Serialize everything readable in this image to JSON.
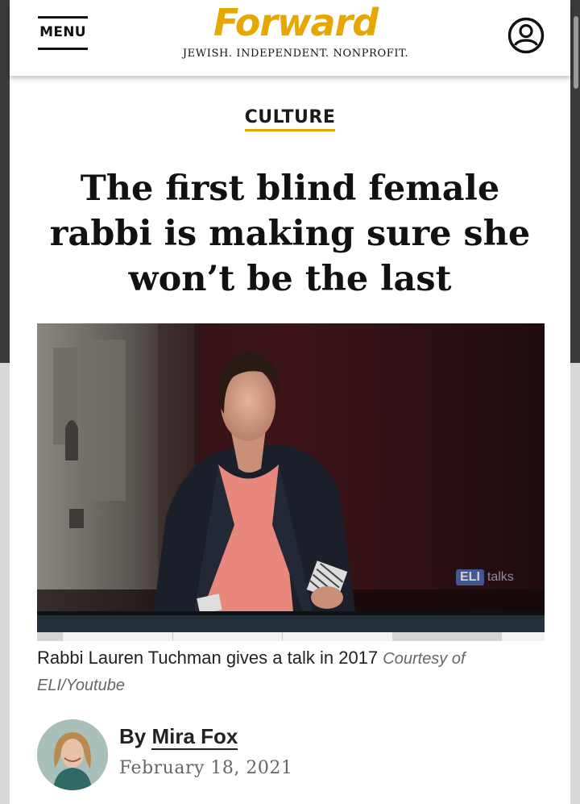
{
  "header": {
    "menu_label": "MENU",
    "logo_text": "Forward",
    "tagline": "JEWISH. INDEPENDENT. NONPROFIT.",
    "account_icon": "user-circle-icon",
    "brand_color": "#e6a800"
  },
  "article": {
    "category": "CULTURE",
    "headline": "The first blind female rabbi is making sure she won’t be the last",
    "hero_watermark": {
      "badge": "ELI",
      "suffix": "talks"
    },
    "caption": "Rabbi Lauren Tuchman gives a talk in 2017",
    "credit": "Courtesy of ELI/Youtube",
    "byline_prefix": "By",
    "author": "Mira Fox",
    "date": "February 18, 2021"
  }
}
